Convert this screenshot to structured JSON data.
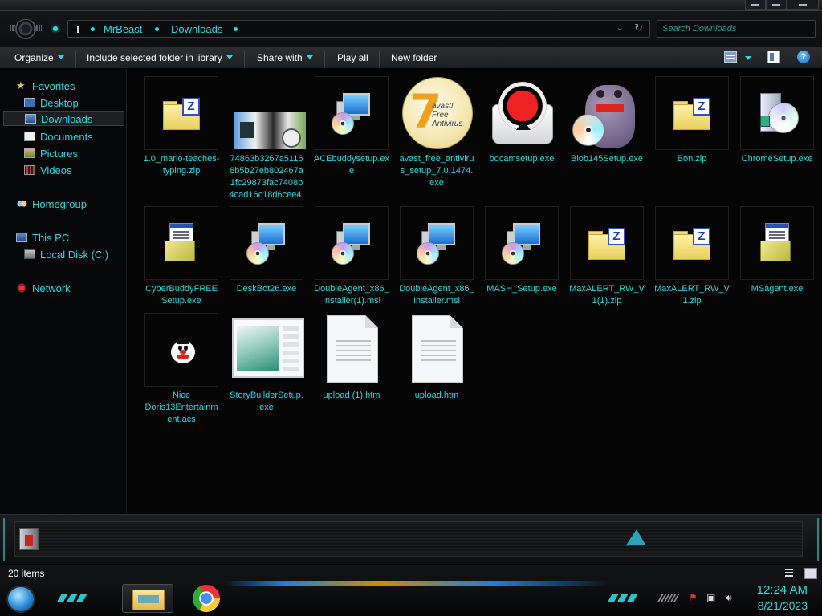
{
  "window": {
    "breadcrumb": [
      "MrBeast",
      "Downloads"
    ],
    "search_placeholder": "Search Downloads"
  },
  "toolbar": {
    "organize": "Organize",
    "include_library": "Include selected folder in library",
    "share_with": "Share with",
    "play_all": "Play all",
    "new_folder": "New folder"
  },
  "nav": {
    "favorites": "Favorites",
    "desktop": "Desktop",
    "downloads": "Downloads",
    "documents": "Documents",
    "pictures": "Pictures",
    "videos": "Videos",
    "homegroup": "Homegroup",
    "this_pc": "This PC",
    "local_disk": "Local Disk (C:)",
    "network": "Network"
  },
  "files": [
    {
      "name": "1.0_mario-teaches-typing.zip",
      "icon": "zip-icon"
    },
    {
      "name": "74863b3267a51168b5b27eb802467a1fc29873fac7408b4cad16c18d6cee4...",
      "icon": "image-thumbnail"
    },
    {
      "name": "ACEbuddysetup.exe",
      "icon": "installer-icon"
    },
    {
      "name": "avast_free_antivirus_setup_7.0.1474.exe",
      "icon": "avast-icon"
    },
    {
      "name": "bdcamsetup.exe",
      "icon": "bandicam-icon"
    },
    {
      "name": "Blob145Setup.exe",
      "icon": "blob-icon"
    },
    {
      "name": "Bon.zip",
      "icon": "zip-icon"
    },
    {
      "name": "ChromeSetup.exe",
      "icon": "cd-box-icon"
    },
    {
      "name": "CyberBuddyFREESetup.exe",
      "icon": "setup-box-icon"
    },
    {
      "name": "DeskBot26.exe",
      "icon": "installer-icon"
    },
    {
      "name": "DoubleAgent_x86_Installer(1).msi",
      "icon": "installer-icon"
    },
    {
      "name": "DoubleAgent_x86_Installer.msi",
      "icon": "installer-icon"
    },
    {
      "name": "MASH_Setup.exe",
      "icon": "installer-icon"
    },
    {
      "name": "MaxALERT_RW_V1(1).zip",
      "icon": "zip-icon"
    },
    {
      "name": "MaxALERT_RW_V1.zip",
      "icon": "zip-icon"
    },
    {
      "name": "MSagent.exe",
      "icon": "setup-box-icon"
    },
    {
      "name": "Nice Doris13Entertainment.acs",
      "icon": "doris-icon"
    },
    {
      "name": "StoryBuilderSetup.exe",
      "icon": "storybuilder-icon"
    },
    {
      "name": "upload (1).htm",
      "icon": "document-icon"
    },
    {
      "name": "upload.htm",
      "icon": "document-icon"
    }
  ],
  "status": {
    "item_count": "20 items"
  },
  "taskbar": {
    "time": "12:24 AM",
    "date": "8/21/2023"
  },
  "colors": {
    "accent": "#2ed8e0",
    "background": "#050506"
  }
}
